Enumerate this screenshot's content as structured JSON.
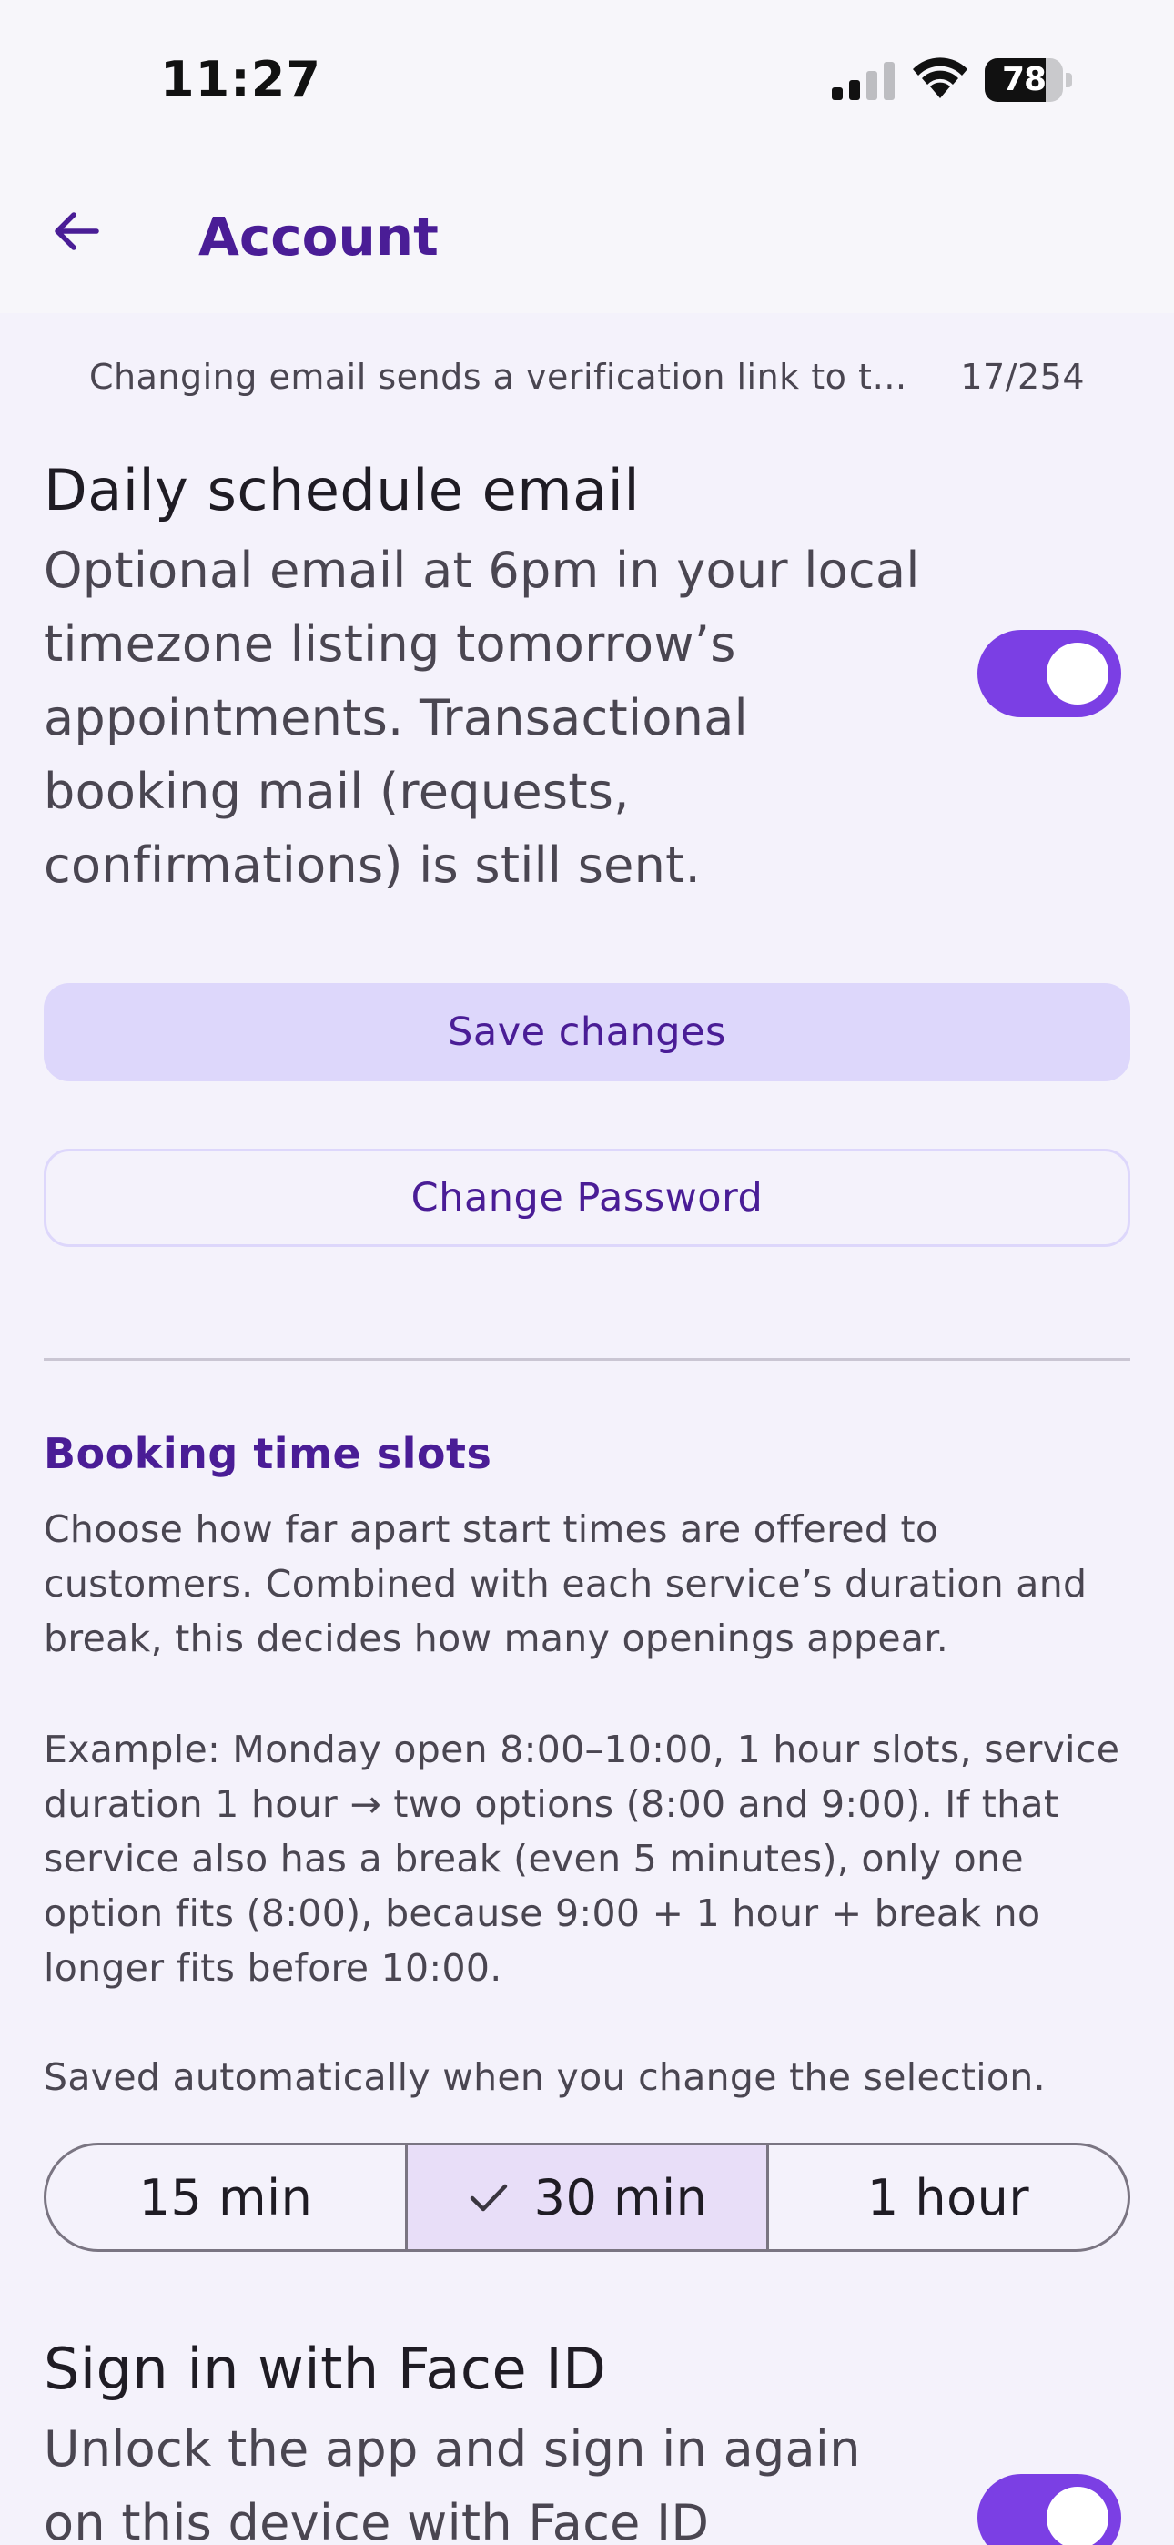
{
  "status_bar": {
    "time": "11:27",
    "battery_level": "78",
    "battery_fraction": 0.78
  },
  "app_bar": {
    "title": "Account",
    "back_icon": "arrow-left-icon"
  },
  "email_field": {
    "helper_text": "Changing email sends a verification link to the new address",
    "char_count": "17/254"
  },
  "daily_schedule": {
    "title": "Daily schedule email",
    "description": "Optional email at 6pm in your local timezone listing tomorrow’s appointments. Transactional booking mail (requests, confirmations) is still sent.",
    "enabled": true
  },
  "buttons": {
    "save_label": "Save changes",
    "change_password_label": "Change Password"
  },
  "booking_slots": {
    "title": "Booking time slots",
    "paragraph1": "Choose how far apart start times are offered to customers. Combined with each service’s duration and break, this decides how many openings appear.",
    "paragraph2": "Example: Monday open 8:00–10:00, 1 hour slots, service duration 1 hour → two options (8:00 and 9:00). If that service also has a break (even 5 minutes), only one option fits (8:00), because 9:00 + 1 hour + break no longer fits before 10:00.",
    "paragraph3": "Saved automatically when you change the selection.",
    "options": [
      "15 min",
      "30 min",
      "1 hour"
    ],
    "selected": "30 min"
  },
  "face_id": {
    "title": "Sign in with Face ID",
    "description": "Unlock the app and sign in again on this device with Face ID",
    "enabled": true
  },
  "colors": {
    "accent": "#7b3fe4",
    "title_purple": "#4a1d96",
    "button_tonal": "#ddd7fb",
    "segment_selected": "#e8def8"
  }
}
